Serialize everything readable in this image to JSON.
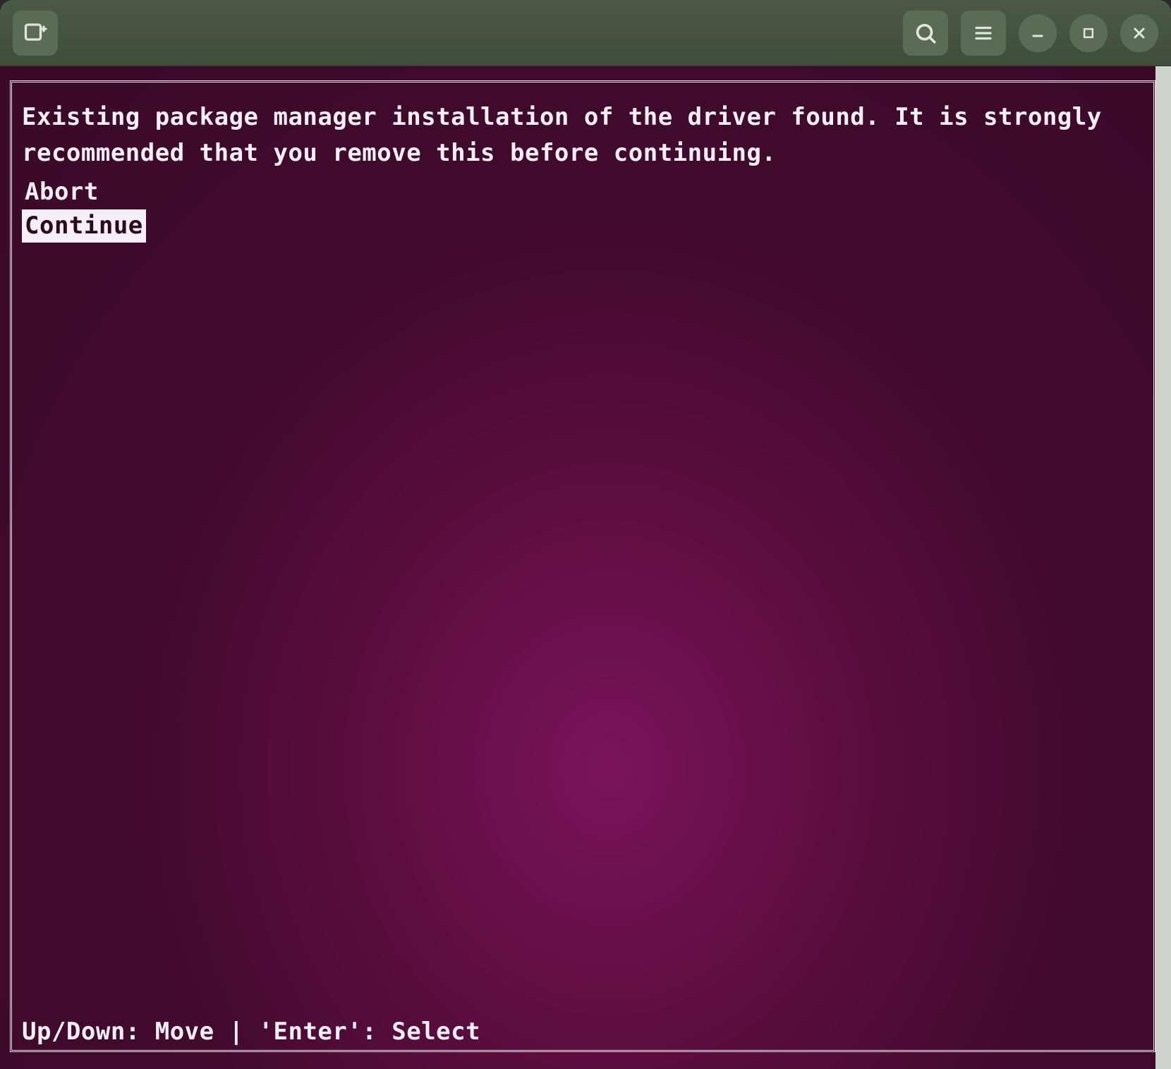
{
  "titlebar": {
    "icons": {
      "new_tab": "terminal-plus-icon",
      "search": "search-icon",
      "menu": "menu-icon",
      "minimize": "minimize-icon",
      "maximize": "maximize-icon",
      "close": "close-icon"
    }
  },
  "dialog": {
    "message": "Existing package manager installation of the driver found. It is strongly recommended that you remove this before continuing.",
    "options": [
      {
        "label": "Abort",
        "selected": false
      },
      {
        "label": "Continue",
        "selected": true
      }
    ],
    "hint": "Up/Down: Move | 'Enter': Select"
  },
  "colors": {
    "terminal_bg": "#4a0f2e",
    "terminal_fg": "#f4eff6",
    "titlebar_bg": "#3f4e3c",
    "button_bg": "#5a6b56"
  }
}
